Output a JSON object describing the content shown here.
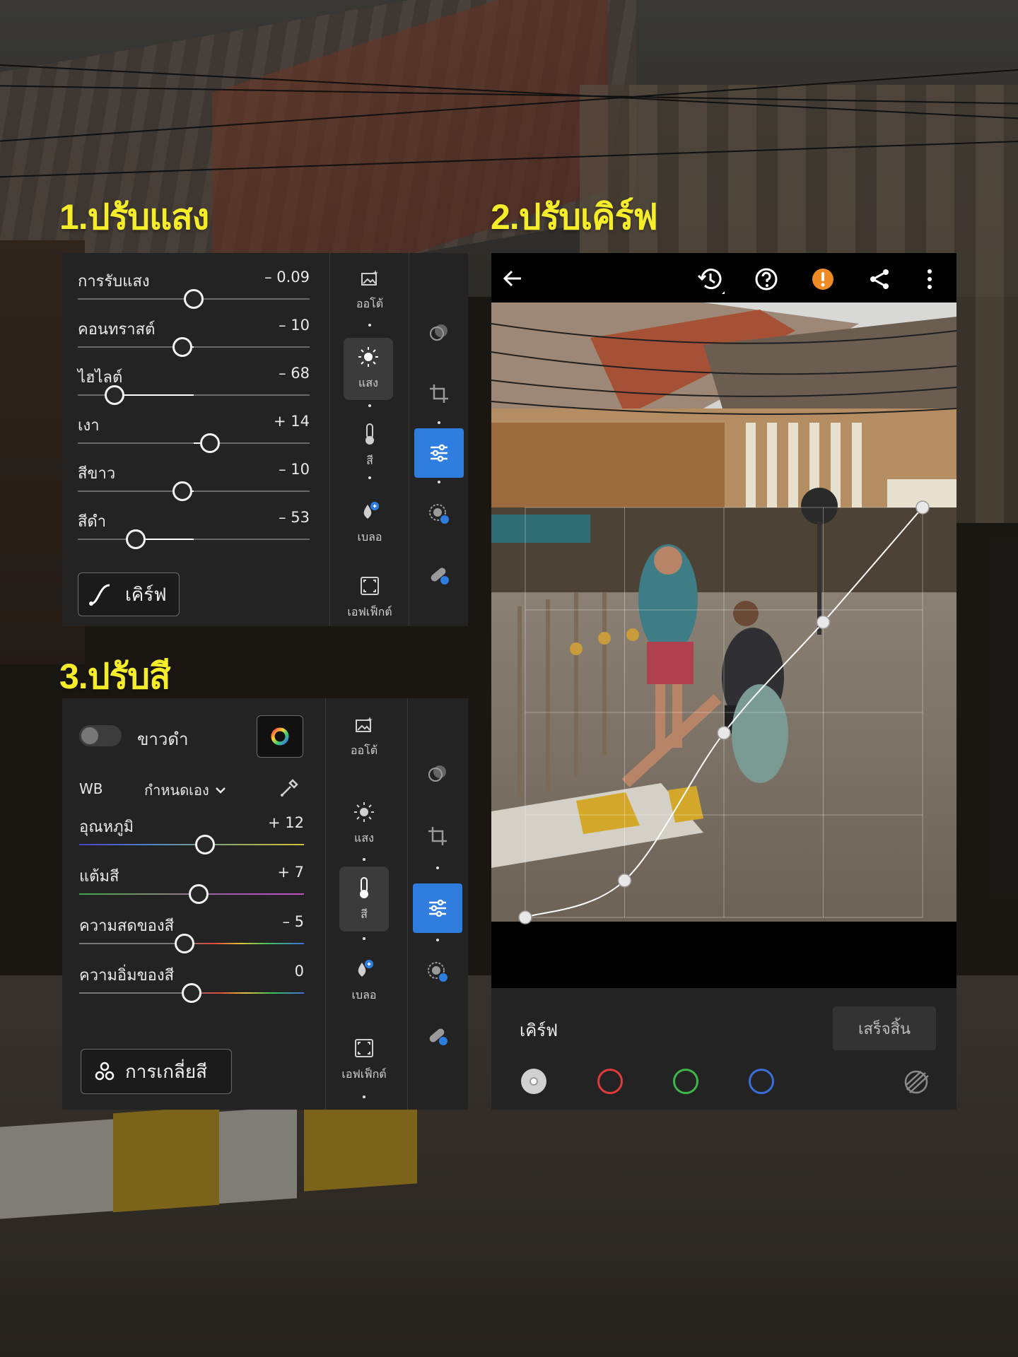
{
  "titles": {
    "light": "1.ปรับแสง",
    "curve": "2.ปรับเคิร์ฟ",
    "color": "3.ปรับสี"
  },
  "light_panel": {
    "sliders": [
      {
        "label": "การรับแสง",
        "value": "– 0.09",
        "level": -0.09
      },
      {
        "label": "คอนทราสต์",
        "value": "– 10",
        "level": -10
      },
      {
        "label": "ไฮไลต์",
        "value": "– 68",
        "level": -68
      },
      {
        "label": "เงา",
        "value": "+ 14",
        "level": 14
      },
      {
        "label": "สีขาว",
        "value": "– 10",
        "level": -10
      },
      {
        "label": "สีดำ",
        "value": "– 53",
        "level": -53
      }
    ],
    "curve_button": "เคิร์ฟ",
    "tools": {
      "auto": "ออโต้",
      "light": "แสง",
      "color": "สี",
      "blur": "เบลอ",
      "effects": "เอฟเฟ็กต์"
    }
  },
  "color_panel": {
    "bw_label": "ขาวดำ",
    "bw_on": false,
    "wb_label": "WB",
    "wb_mode": "กำหนดเอง",
    "sliders": [
      {
        "label": "อุณหภูมิ",
        "value": "+ 12",
        "level": 12
      },
      {
        "label": "แต้มสี",
        "value": "+ 7",
        "level": 7
      },
      {
        "label": "ความสดของสี",
        "value": "– 5",
        "level": -5
      },
      {
        "label": "ความอิ่มของสี",
        "value": "0",
        "level": 0
      }
    ],
    "mix_button": "การเกลี่ยสี",
    "tools": {
      "auto": "ออโต้",
      "light": "แสง",
      "color": "สี",
      "blur": "เบลอ",
      "effects": "เอฟเฟ็กต์"
    }
  },
  "curve_editor": {
    "title": "เคิร์ฟ",
    "done_button": "เสร็จสิ้น",
    "channels": [
      "luminance",
      "red",
      "green",
      "blue"
    ],
    "channel_colors": {
      "luminance": "#d0d0d0",
      "red": "#e23a3a",
      "green": "#3fb54a",
      "blue": "#3a6fd8"
    },
    "curve_points": [
      [
        0.0,
        0.0
      ],
      [
        0.25,
        0.09
      ],
      [
        0.5,
        0.45
      ],
      [
        0.75,
        0.72
      ],
      [
        1.0,
        1.0
      ]
    ]
  },
  "colors": {
    "accent": "#2e7ddf",
    "title_yellow": "#f5ec2a",
    "warning": "#f08a24"
  }
}
